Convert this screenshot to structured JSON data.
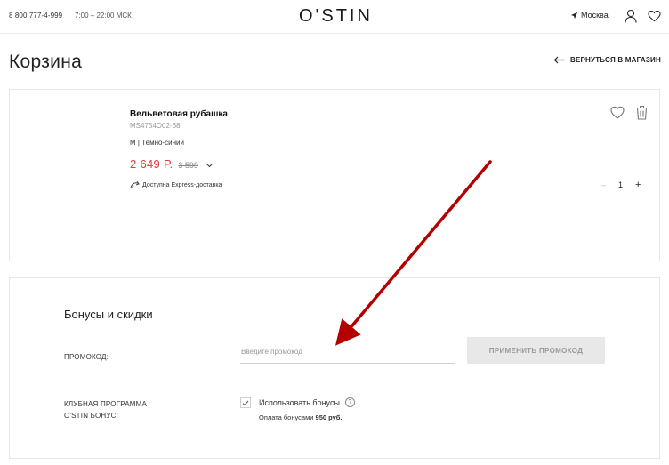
{
  "header": {
    "phone": "8 800 777-4-999",
    "hours": "7:00 – 22:00 МСК",
    "logo": "O'STIN",
    "city": "Москва",
    "icons": [
      "location-arrow-icon",
      "user-icon",
      "heart-icon"
    ]
  },
  "page": {
    "title": "Корзина",
    "back_label": "ВЕРНУТЬСЯ В МАГАЗИН"
  },
  "cart": {
    "item": {
      "name": "Вельветовая рубашка",
      "sku": "MS4754O02-68",
      "variant": "M | Темно-синий",
      "price_current": "2 649 Р.",
      "price_old": "3 599",
      "delivery": "Доступна Express-доставка",
      "quantity_minus": "–",
      "quantity": "1",
      "quantity_plus": "+"
    }
  },
  "bonuses": {
    "title": "Бонусы и скидки",
    "promo_label": "ПРОМОКОД:",
    "promo_placeholder": "Введите промокод",
    "apply_button": "ПРИМЕНИТЬ ПРОМОКОД",
    "club_label_line1": "КЛУБНАЯ ПРОГРАММА",
    "club_label_line2": "O'STIN БОНУС:",
    "use_bonus_label": "Использовать бонусы",
    "use_bonus_checked": true,
    "pay_bonus_prefix": "Оплата бонусами",
    "pay_bonus_amount": "950 руб."
  },
  "colors": {
    "price": "#e53935",
    "annotation_arrow": "#b40000"
  }
}
